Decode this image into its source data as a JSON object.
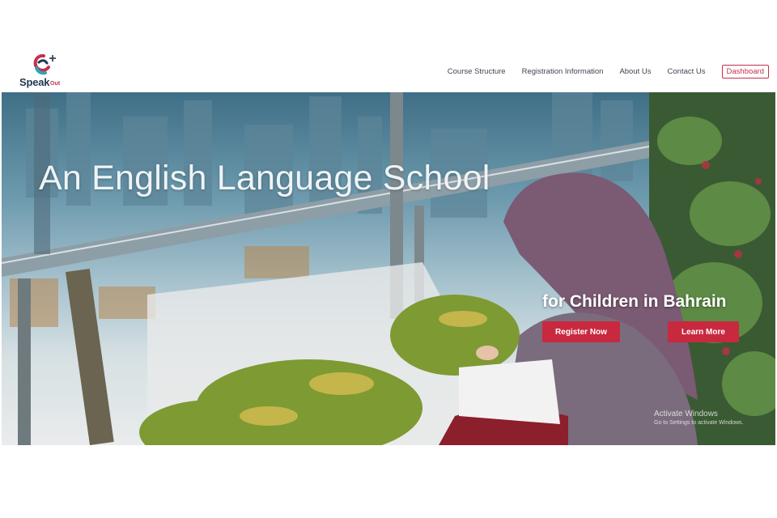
{
  "brand": {
    "name": "Speak",
    "suffix": "Out"
  },
  "nav": {
    "links": [
      "Course Structure",
      "Registration Information",
      "About Us",
      "Contact Us"
    ],
    "dashboard_label": "Dashboard"
  },
  "hero": {
    "title": "An English Language School",
    "subtitle": "for Children in Bahrain",
    "register_label": "Register Now",
    "learn_label": "Learn More"
  },
  "watermark": {
    "title": "Activate Windows",
    "subtitle": "Go to Settings to activate Windows."
  },
  "colors": {
    "accent": "#c8293f",
    "brand_blue": "#1f3850",
    "brand_red": "#c4314b"
  }
}
